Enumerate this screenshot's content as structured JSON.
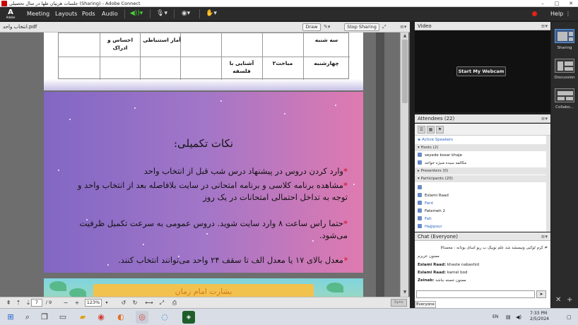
{
  "window": {
    "title": "جلسات هربیان طها در سال تحصیلی (Sharing) - Adobe Connect",
    "minimize": "–",
    "maximize": "□",
    "close": "✕"
  },
  "menubar": {
    "logo_text": "A",
    "logo_sub": "Adobe",
    "items": [
      "Meeting",
      "Layouts",
      "Pods",
      "Audio"
    ],
    "help": "Help",
    "right_icons": "⋮  ▤"
  },
  "share": {
    "filename": "انتخاب واحد.pdf",
    "draw_label": "Draw",
    "stop_label": "Stop Sharing",
    "table": {
      "row1_day": "سه شنبه",
      "row1_c1": "آمار استنباطی",
      "row1_c2": "احساس و ادراک",
      "row2_day": "چهارشنبه",
      "row2_c1": "مباحث۲",
      "row2_c2": "آشنایی با فلسفه"
    },
    "notes": {
      "heading": "نکات تکمیلی:",
      "star": "*",
      "line1": "وارد کردن دروس در پیشنهاد درس شب قبل از انتخاب واحد",
      "line2": "مشاهده برنامه کلاسی و برنامه امتحانی در سایت بلافاصله بعد از انتخاب واحد و توجه به تداخل احتمالی امتحانات در یک روز",
      "line3": "حتما راس ساعت ۸ وارد سایت شوید. دروس عمومی به سرعت تکمیل ظرفیت می‌شود.",
      "line4": "معدل بالای ۱۷ یا معدل الف تا سقف ۲۴ واحد می‌توانند انتخاب کنند."
    },
    "page3_text": "بشارت امام زمان",
    "footer": {
      "page_current": "7",
      "page_total": "/ 9",
      "zoom": "123%",
      "sync": "Sync"
    }
  },
  "video": {
    "title": "Video",
    "button": "Start My Webcam"
  },
  "attendees": {
    "title": "Attendees",
    "count": "(22)",
    "active_speakers": "Active Speakers",
    "hosts_group": "Hosts (2)",
    "hosts": [
      "seyede kosar khaje",
      "مکالمه سیده منیژه خواجه"
    ],
    "presenters_group": "Presenters (0)",
    "participants_group": "Participants (20)",
    "participants": [
      "",
      "Eslami Raad",
      "Fard",
      "Fatemeh 2",
      "Fati",
      "Hajjipour"
    ]
  },
  "chat": {
    "title": "Chat",
    "scope": "(Everyone)",
    "messages": [
      {
        "who": "",
        "text": "≠ کرم لوکبی ونیسشد شد علم نویبک ب ریو اسای بودانه : محمدالا"
      },
      {
        "who": "",
        "text": "ممنون عزیزم"
      },
      {
        "who": "Eslami Raad:",
        "text": " khaste nabashid"
      },
      {
        "who": "Eslami Raad:",
        "text": " kamel bod"
      },
      {
        "who": "Zeinab:",
        "text": " ممنون خسته نباشد"
      }
    ],
    "tab": "Everyone"
  },
  "rail": {
    "sharing": "Sharing",
    "discussion": "Discussion",
    "collaboration": "Collabo..."
  },
  "taskbar": {
    "lang": "EN",
    "time": "7:33 PM",
    "date": "2/5/2024"
  },
  "colors": {
    "menubar": "#2b2b2b",
    "notes_gradient_start": "#8167c4",
    "notes_gradient_end": "#e07ab0",
    "star": "#d21f3c",
    "record": "#e0231b"
  }
}
